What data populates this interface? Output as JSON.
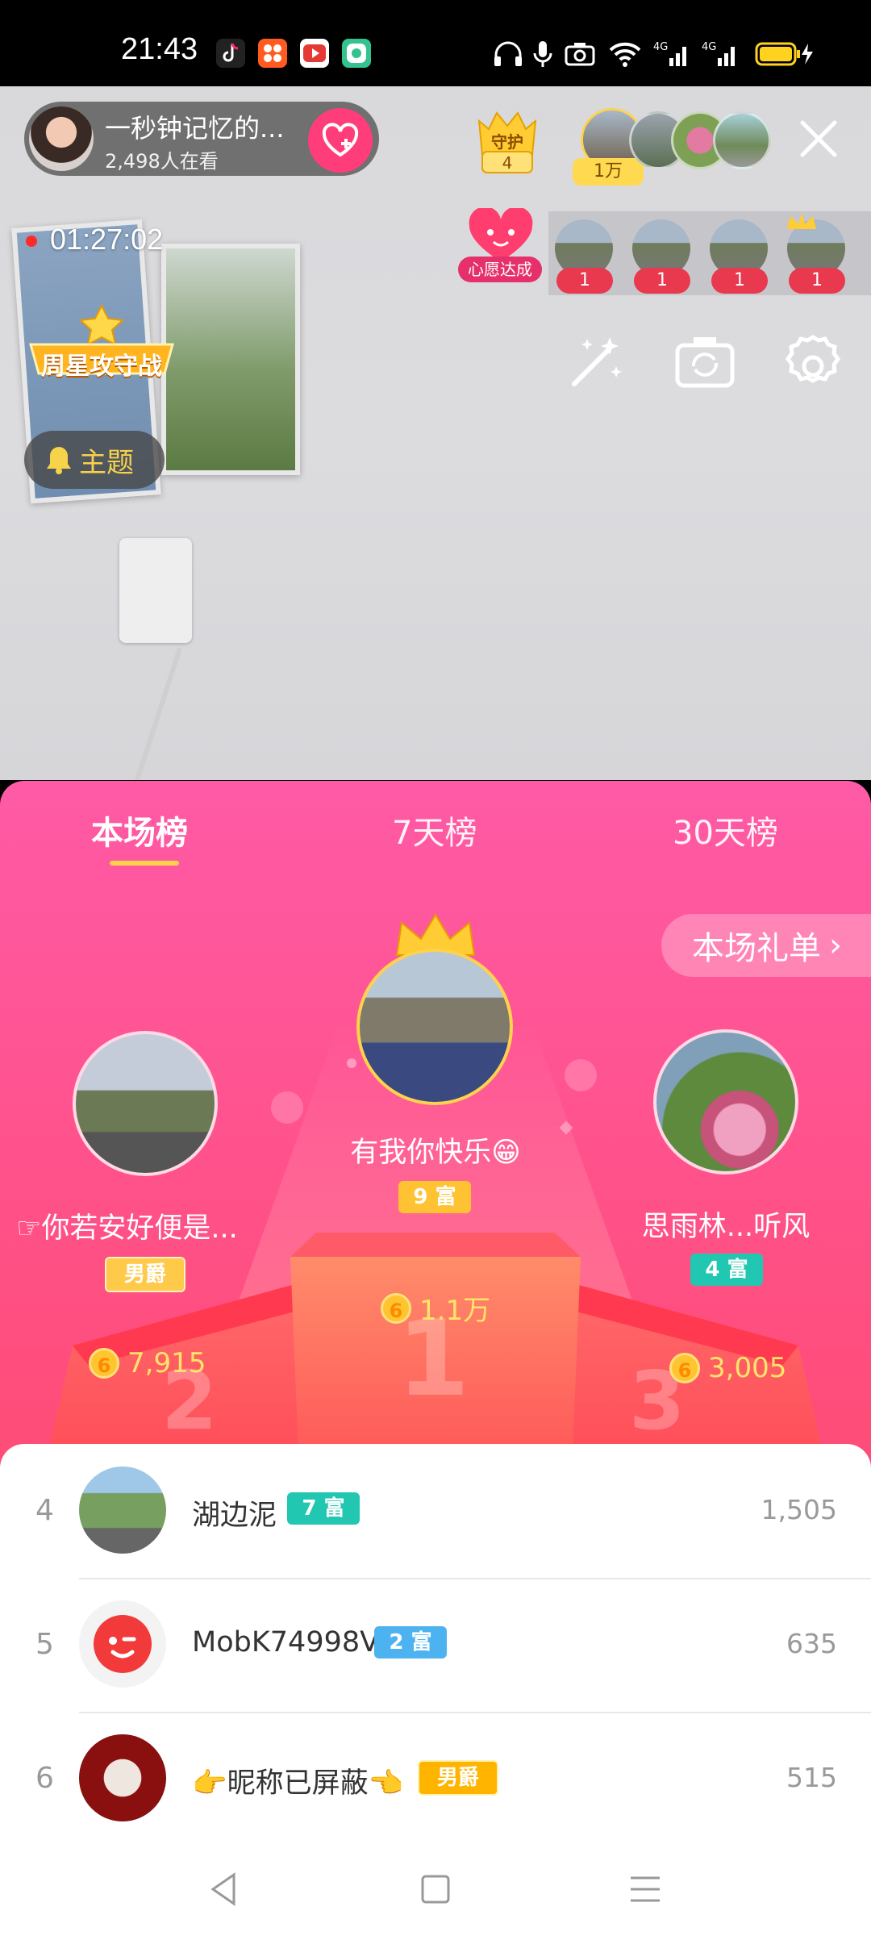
{
  "status_bar": {
    "time": "21:43"
  },
  "host": {
    "name": "一秒钟记忆的...",
    "viewers": "2,498人在看"
  },
  "guard": {
    "label": "守护",
    "count": "4"
  },
  "fans": {
    "count_badge": "1万"
  },
  "wishes": {
    "label": "心愿达成",
    "counts": [
      "1",
      "1",
      "1",
      "1"
    ]
  },
  "live": {
    "elapsed": "01:27:02"
  },
  "event_badge": {
    "label": "周星攻守战"
  },
  "theme_button": {
    "label": "主题"
  },
  "tabs": [
    {
      "label": "本场榜",
      "active": true
    },
    {
      "label": "7天榜",
      "active": false
    },
    {
      "label": "30天榜",
      "active": false
    }
  ],
  "gift_list_button": {
    "label": "本场礼单",
    "arrow": "›"
  },
  "podium": {
    "first": {
      "name": "有我你快乐😁",
      "level": "9 富",
      "score": "1.1万",
      "rank": "1"
    },
    "second": {
      "name": "☞你若安好便是...",
      "level": "男爵",
      "score": "7,915",
      "rank": "2"
    },
    "third": {
      "name": "思雨林...听风",
      "level": "4 富",
      "score": "3,005",
      "rank": "3"
    }
  },
  "rank_list": [
    {
      "rank": "4",
      "name": "湖边泥",
      "level": "7 富",
      "level_color": "#21c7b0",
      "score": "1,505"
    },
    {
      "rank": "5",
      "name": "MobK74998V",
      "level": "2 富",
      "level_color": "#4cb3f0",
      "score": "635"
    },
    {
      "rank": "6",
      "name": "👉昵称已屏蔽👈",
      "level": "男爵",
      "level_color": "#ffb400",
      "score": "515"
    }
  ],
  "colors": {
    "panel_top": "#ff5aa6",
    "panel_bottom": "#ff5063",
    "accent_gold": "#ffd24e",
    "follow_pink": "#ff3d7a"
  }
}
